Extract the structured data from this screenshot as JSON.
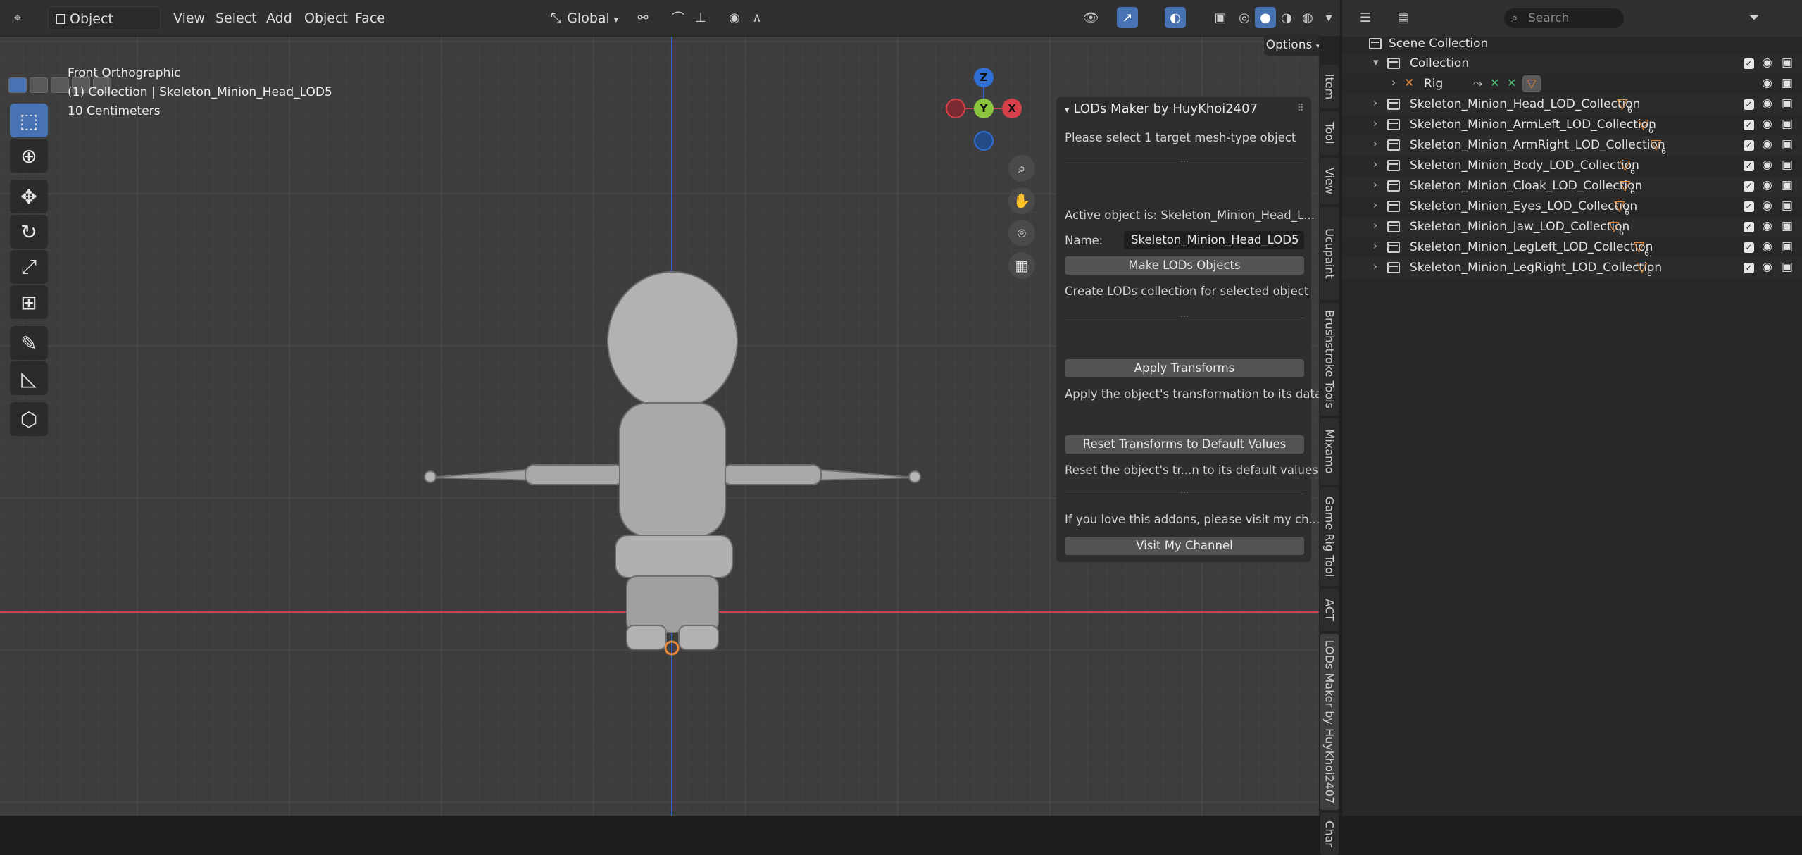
{
  "header": {
    "mode": "Object Mode",
    "menus": [
      "View",
      "Select",
      "Add",
      "Object",
      "Face"
    ],
    "transform_orientation": "Global",
    "options_label": "Options"
  },
  "viewport": {
    "view_name": "Front Orthographic",
    "collection_info": "(1) Collection | Skeleton_Minion_Head_LOD5",
    "scale_label": "10 Centimeters",
    "gizmo": {
      "z": "Z",
      "y": "Y",
      "x": "X"
    },
    "colors": {
      "x_axis": "#c8424f",
      "y_axis": "#8cc63f",
      "z_axis": "#2f5fc4",
      "active": "#4772b3"
    }
  },
  "panel": {
    "title": "LODs Maker by HuyKhoi2407",
    "hint": "Please select 1 target mesh-type object",
    "separator": "...",
    "active_object": "Active object is: Skeleton_Minion_Head_L...",
    "name_label": "Name:",
    "name_value": "Skeleton_Minion_Head_LOD5",
    "make_lods_button": "Make LODs Objects",
    "make_lods_desc": "Create LODs collection for selected object",
    "apply_transforms_button": "Apply Transforms",
    "apply_transforms_desc": "Apply the object's transformation to its data.",
    "reset_button": "Reset Transforms to Default Values",
    "reset_desc": "Reset the object's tr...n to its default values.",
    "channel_desc": "If you love this addons, please visit my ch...",
    "channel_button": "Visit My Channel"
  },
  "side_tabs": [
    "Item",
    "Tool",
    "View",
    "Ucupaint",
    "Brushstroke Tools",
    "Mixamo",
    "Game Rig Tool",
    "ACT",
    "LODs Maker by HuyKhoi2407",
    "Char"
  ],
  "outliner": {
    "search_placeholder": "Search",
    "scene_collection": "Scene Collection",
    "collection": "Collection",
    "rig": "Rig",
    "items": [
      {
        "label": "Skeleton_Minion_Head_LOD_Collection",
        "count": "6"
      },
      {
        "label": "Skeleton_Minion_ArmLeft_LOD_Collection",
        "count": "6"
      },
      {
        "label": "Skeleton_Minion_ArmRight_LOD_Collection",
        "count": "6"
      },
      {
        "label": "Skeleton_Minion_Body_LOD_Collection",
        "count": "6"
      },
      {
        "label": "Skeleton_Minion_Cloak_LOD_Collection",
        "count": "6"
      },
      {
        "label": "Skeleton_Minion_Eyes_LOD_Collection",
        "count": "6"
      },
      {
        "label": "Skeleton_Minion_Jaw_LOD_Collection",
        "count": "6"
      },
      {
        "label": "Skeleton_Minion_LegLeft_LOD_Collection",
        "count": "6"
      },
      {
        "label": "Skeleton_Minion_LegRight_LOD_Collection",
        "count": "6"
      }
    ]
  }
}
